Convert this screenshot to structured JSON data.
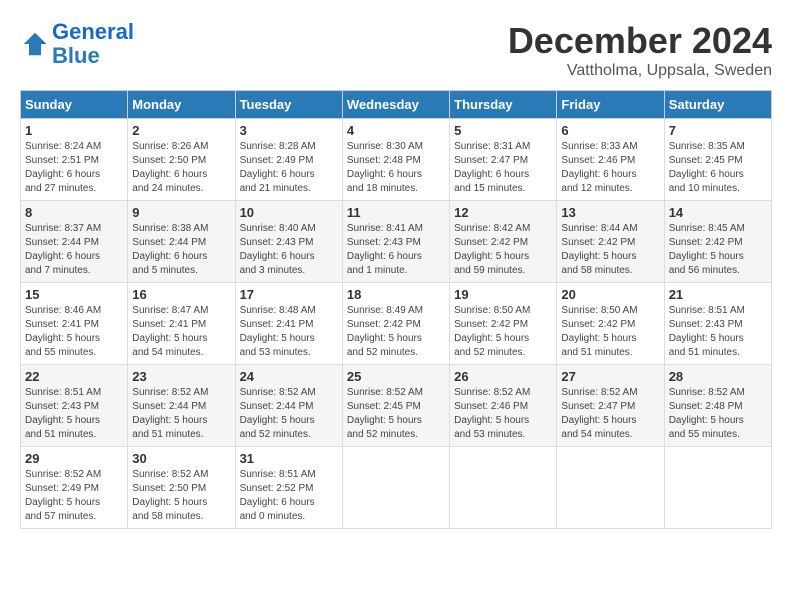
{
  "header": {
    "logo_line1": "General",
    "logo_line2": "Blue",
    "month": "December 2024",
    "location": "Vattholma, Uppsala, Sweden"
  },
  "days_of_week": [
    "Sunday",
    "Monday",
    "Tuesday",
    "Wednesday",
    "Thursday",
    "Friday",
    "Saturday"
  ],
  "weeks": [
    [
      {
        "day": "1",
        "info": "Sunrise: 8:24 AM\nSunset: 2:51 PM\nDaylight: 6 hours\nand 27 minutes."
      },
      {
        "day": "2",
        "info": "Sunrise: 8:26 AM\nSunset: 2:50 PM\nDaylight: 6 hours\nand 24 minutes."
      },
      {
        "day": "3",
        "info": "Sunrise: 8:28 AM\nSunset: 2:49 PM\nDaylight: 6 hours\nand 21 minutes."
      },
      {
        "day": "4",
        "info": "Sunrise: 8:30 AM\nSunset: 2:48 PM\nDaylight: 6 hours\nand 18 minutes."
      },
      {
        "day": "5",
        "info": "Sunrise: 8:31 AM\nSunset: 2:47 PM\nDaylight: 6 hours\nand 15 minutes."
      },
      {
        "day": "6",
        "info": "Sunrise: 8:33 AM\nSunset: 2:46 PM\nDaylight: 6 hours\nand 12 minutes."
      },
      {
        "day": "7",
        "info": "Sunrise: 8:35 AM\nSunset: 2:45 PM\nDaylight: 6 hours\nand 10 minutes."
      }
    ],
    [
      {
        "day": "8",
        "info": "Sunrise: 8:37 AM\nSunset: 2:44 PM\nDaylight: 6 hours\nand 7 minutes."
      },
      {
        "day": "9",
        "info": "Sunrise: 8:38 AM\nSunset: 2:44 PM\nDaylight: 6 hours\nand 5 minutes."
      },
      {
        "day": "10",
        "info": "Sunrise: 8:40 AM\nSunset: 2:43 PM\nDaylight: 6 hours\nand 3 minutes."
      },
      {
        "day": "11",
        "info": "Sunrise: 8:41 AM\nSunset: 2:43 PM\nDaylight: 6 hours\nand 1 minute."
      },
      {
        "day": "12",
        "info": "Sunrise: 8:42 AM\nSunset: 2:42 PM\nDaylight: 5 hours\nand 59 minutes."
      },
      {
        "day": "13",
        "info": "Sunrise: 8:44 AM\nSunset: 2:42 PM\nDaylight: 5 hours\nand 58 minutes."
      },
      {
        "day": "14",
        "info": "Sunrise: 8:45 AM\nSunset: 2:42 PM\nDaylight: 5 hours\nand 56 minutes."
      }
    ],
    [
      {
        "day": "15",
        "info": "Sunrise: 8:46 AM\nSunset: 2:41 PM\nDaylight: 5 hours\nand 55 minutes."
      },
      {
        "day": "16",
        "info": "Sunrise: 8:47 AM\nSunset: 2:41 PM\nDaylight: 5 hours\nand 54 minutes."
      },
      {
        "day": "17",
        "info": "Sunrise: 8:48 AM\nSunset: 2:41 PM\nDaylight: 5 hours\nand 53 minutes."
      },
      {
        "day": "18",
        "info": "Sunrise: 8:49 AM\nSunset: 2:42 PM\nDaylight: 5 hours\nand 52 minutes."
      },
      {
        "day": "19",
        "info": "Sunrise: 8:50 AM\nSunset: 2:42 PM\nDaylight: 5 hours\nand 52 minutes."
      },
      {
        "day": "20",
        "info": "Sunrise: 8:50 AM\nSunset: 2:42 PM\nDaylight: 5 hours\nand 51 minutes."
      },
      {
        "day": "21",
        "info": "Sunrise: 8:51 AM\nSunset: 2:43 PM\nDaylight: 5 hours\nand 51 minutes."
      }
    ],
    [
      {
        "day": "22",
        "info": "Sunrise: 8:51 AM\nSunset: 2:43 PM\nDaylight: 5 hours\nand 51 minutes."
      },
      {
        "day": "23",
        "info": "Sunrise: 8:52 AM\nSunset: 2:44 PM\nDaylight: 5 hours\nand 51 minutes."
      },
      {
        "day": "24",
        "info": "Sunrise: 8:52 AM\nSunset: 2:44 PM\nDaylight: 5 hours\nand 52 minutes."
      },
      {
        "day": "25",
        "info": "Sunrise: 8:52 AM\nSunset: 2:45 PM\nDaylight: 5 hours\nand 52 minutes."
      },
      {
        "day": "26",
        "info": "Sunrise: 8:52 AM\nSunset: 2:46 PM\nDaylight: 5 hours\nand 53 minutes."
      },
      {
        "day": "27",
        "info": "Sunrise: 8:52 AM\nSunset: 2:47 PM\nDaylight: 5 hours\nand 54 minutes."
      },
      {
        "day": "28",
        "info": "Sunrise: 8:52 AM\nSunset: 2:48 PM\nDaylight: 5 hours\nand 55 minutes."
      }
    ],
    [
      {
        "day": "29",
        "info": "Sunrise: 8:52 AM\nSunset: 2:49 PM\nDaylight: 5 hours\nand 57 minutes."
      },
      {
        "day": "30",
        "info": "Sunrise: 8:52 AM\nSunset: 2:50 PM\nDaylight: 5 hours\nand 58 minutes."
      },
      {
        "day": "31",
        "info": "Sunrise: 8:51 AM\nSunset: 2:52 PM\nDaylight: 6 hours\nand 0 minutes."
      },
      {
        "day": "",
        "info": ""
      },
      {
        "day": "",
        "info": ""
      },
      {
        "day": "",
        "info": ""
      },
      {
        "day": "",
        "info": ""
      }
    ]
  ]
}
